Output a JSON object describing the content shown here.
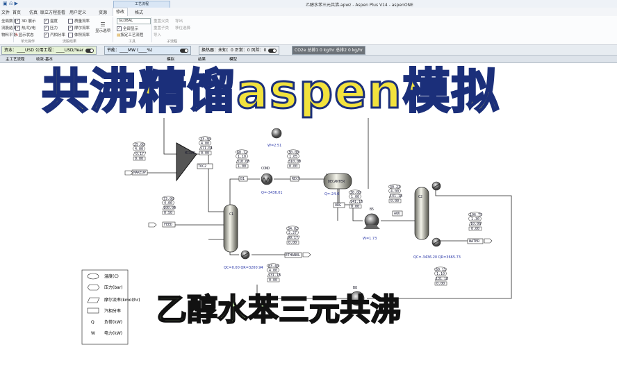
{
  "window": {
    "title": "乙醇水苯三元共沸.apwz - Aspen Plus V14 - aspenONE",
    "context_tab": "工艺流程"
  },
  "ribbon_tabs": [
    "文件",
    "首页",
    "仿真",
    "联立方程",
    "查看",
    "用户定义",
    "资源",
    "修改",
    "格式"
  ],
  "ribbon": {
    "col1": [
      "全局数据",
      "流股结果",
      "物料平衡"
    ],
    "col2": [
      "3D 展示",
      "热/功/电",
      "显示状态"
    ],
    "col3": [
      "温度",
      "压力",
      "汽相分率"
    ],
    "col4": [
      "质量流率",
      "摩尔流率",
      "体积流率"
    ],
    "present_label": "显示选项",
    "combo_value": "GLOBAL",
    "col5": [
      "全部显示",
      "按定工艺流程"
    ],
    "col6": [
      "重置父类",
      "重置子类",
      "导入"
    ],
    "col7": [
      "导出",
      "移位选择"
    ],
    "groups": [
      "单元操作",
      "流股结果",
      "显示",
      "工具",
      "子流程"
    ]
  },
  "econ": {
    "capital": "资本：____USD  公用工程：____USD/Year",
    "energy": "节能：____MW  (____%)",
    "exchangers": "换热器：未知：0  正常：0  风险：0",
    "co2": "CO2e 总排1 0 kg/hr  总排2 0 kg/hr"
  },
  "flowsheet_tabs": [
    "主工艺流程",
    "收敛-基本",
    "模拟",
    "结果",
    "模型"
  ],
  "banner": "共沸精馏aspen模拟",
  "subbanner": "乙醇水苯三元共沸",
  "blocks": {
    "mixer": "MIXER",
    "column1": "C1",
    "condenser": "COND",
    "decanter": "DECANTER",
    "pump": "B5",
    "column2": "C2",
    "pump2": "B8"
  },
  "streams": [
    "MAKEUP",
    "FEED",
    "ETHANOL",
    "WATER",
    "TOC2",
    "B1",
    "ORG",
    "AQU",
    "RECY"
  ],
  "stream_tables": {
    "makeup": [
      "25.00",
      "4.00",
      "0.17",
      "0.00"
    ],
    "mixout": [
      "33.30",
      "4.00",
      "171.01",
      "0.00"
    ],
    "feed": [
      "73.00",
      "4.00",
      "100.00",
      "0.50"
    ],
    "vap1": [
      "68.72",
      "1.10",
      "310.00",
      "1.00"
    ],
    "cond": [
      "30.00",
      "1.05",
      "310.00",
      "0.00"
    ],
    "org": [
      "30.00",
      "1.00",
      "141.18",
      "0.00"
    ],
    "aq2": [
      "30.23",
      "4.00",
      "141.18",
      "0.00"
    ],
    "eth": [
      "34.02",
      "2.27",
      "90.17",
      "0.00"
    ],
    "bot1": [
      "83.40",
      "4.00",
      "131.18",
      "0.00"
    ],
    "water": [
      "106.75",
      "1.30",
      "10.00",
      "0.00"
    ],
    "recy": [
      "60.15",
      "1.10",
      "131.18",
      "0.00"
    ]
  },
  "duties": {
    "pump0": "W=2.51",
    "cond": "Q=-3436.01",
    "dec": "Q=-24.0",
    "c1": "QC=0.00 QR=3200.94",
    "b5": "W=1.73",
    "c2": "QC=-3436.20 QR=3665.73"
  },
  "legend": [
    {
      "icon": "oval",
      "label": "温度(C)"
    },
    {
      "icon": "hexagon",
      "label": "压力(bar)"
    },
    {
      "icon": "parallelogram",
      "label": "摩尔流率(kmol/hr)"
    },
    {
      "icon": "rect",
      "label": "汽相分率"
    },
    {
      "icon": "Q",
      "label": "负荷(kW)"
    },
    {
      "icon": "W",
      "label": "电力(kW)"
    }
  ]
}
